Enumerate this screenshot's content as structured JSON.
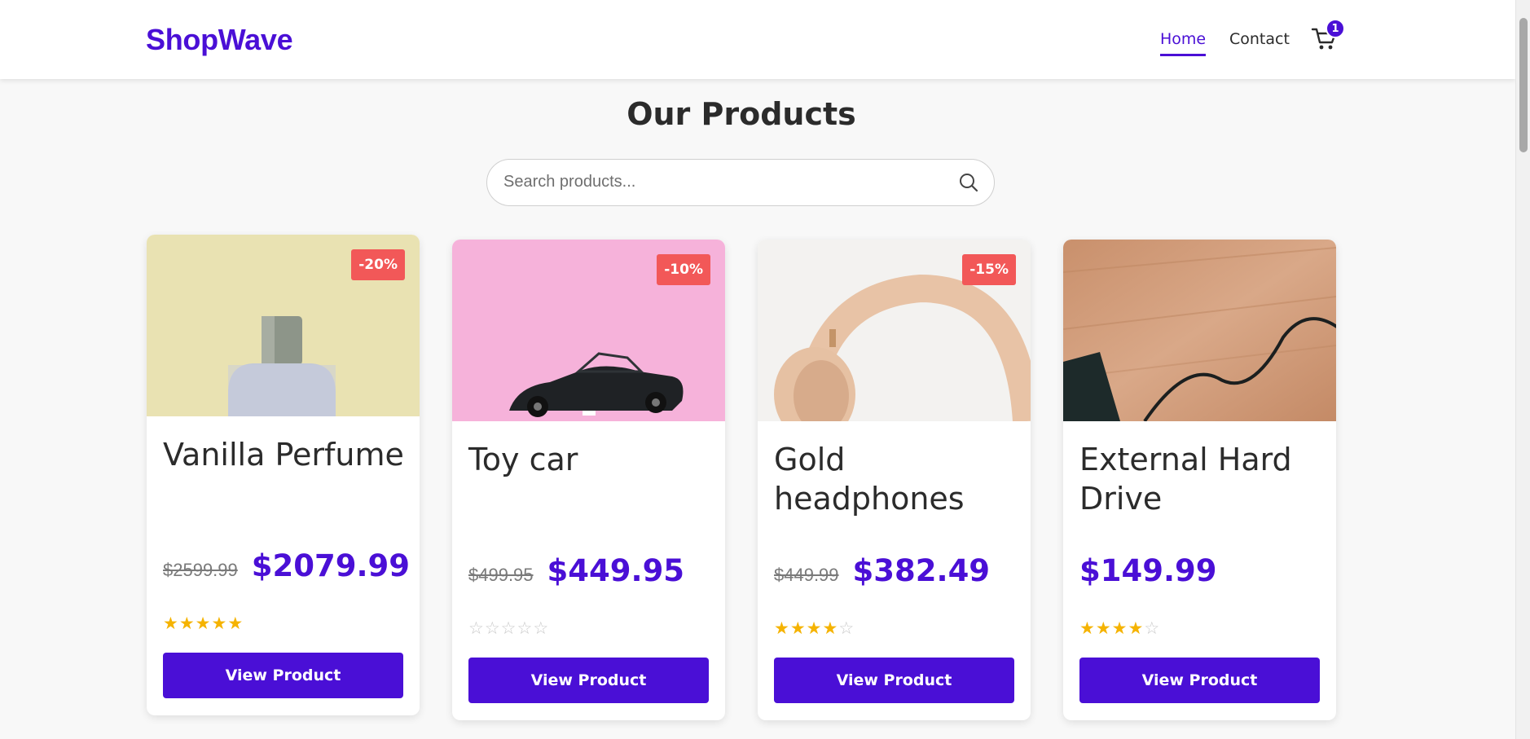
{
  "header": {
    "logo": "ShopWave",
    "nav": [
      {
        "label": "Home",
        "active": true
      },
      {
        "label": "Contact",
        "active": false
      }
    ],
    "cart_count": "1",
    "cart_icon": "cart-icon"
  },
  "page": {
    "title": "Our Products",
    "search": {
      "placeholder": "Search products...",
      "value": "",
      "icon": "search-icon"
    }
  },
  "products": [
    {
      "name": "Vanilla Perfume",
      "badge": "-20%",
      "old_price": "$2599.99",
      "price": "$2079.99",
      "rating": 5,
      "button": "View Product"
    },
    {
      "name": "Toy car",
      "badge": "-10%",
      "old_price": "$499.95",
      "price": "$449.95",
      "rating": 0,
      "button": "View Product"
    },
    {
      "name": "Gold headphones",
      "badge": "-15%",
      "old_price": "$449.99",
      "price": "$382.49",
      "rating": 4,
      "button": "View Product"
    },
    {
      "name": "External Hard Drive",
      "badge": "",
      "old_price": "",
      "price": "$149.99",
      "rating": 4,
      "button": "View Product"
    }
  ],
  "colors": {
    "accent": "#4a0fd6",
    "badge": "#f25858",
    "star": "#f5b301"
  }
}
